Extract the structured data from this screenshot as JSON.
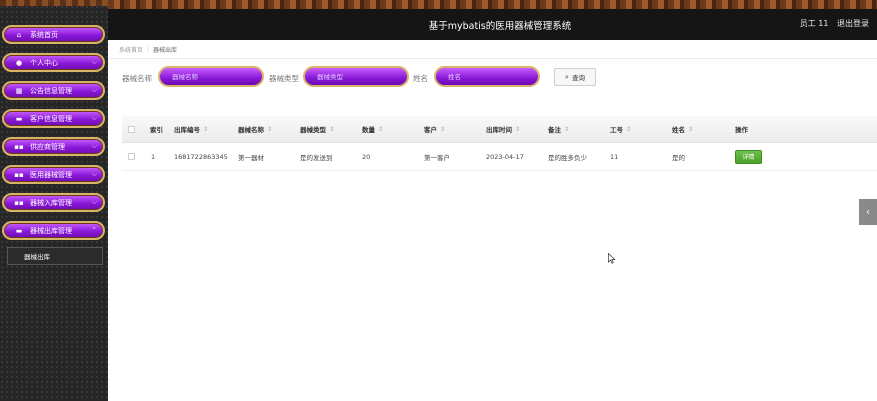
{
  "header": {
    "title": "基于mybatis的医用器械管理系统",
    "user": "员工 11",
    "logout": "退出登录"
  },
  "sidebar": {
    "items": [
      {
        "label": "系统首页",
        "icon": "home-icon",
        "glyph": "⌂",
        "chevron": false
      },
      {
        "label": "个人中心",
        "icon": "user-icon",
        "glyph": "●",
        "chevron": true
      },
      {
        "label": "公告信息管理",
        "icon": "calendar-icon",
        "glyph": "▦",
        "chevron": true
      },
      {
        "label": "客户信息管理",
        "icon": "briefcase-icon",
        "glyph": "▬",
        "chevron": true
      },
      {
        "label": "供应商管理",
        "icon": "grid-icon",
        "glyph": "▪▪",
        "chevron": true
      },
      {
        "label": "医用器械管理",
        "icon": "grid-icon",
        "glyph": "▪▪",
        "chevron": true
      },
      {
        "label": "器械入库管理",
        "icon": "grid-icon",
        "glyph": "▪▪",
        "chevron": true
      },
      {
        "label": "器械出库管理",
        "icon": "comment-icon",
        "glyph": "▬",
        "chevron": true,
        "expanded": true
      }
    ],
    "submenu": "器械出库"
  },
  "breadcrumb": {
    "home": "系统首页",
    "current": "器械出库"
  },
  "search": {
    "name_label": "器械名称",
    "name_placeholder": "器械名称",
    "type_label": "器械类型",
    "type_placeholder": "器械类型",
    "person_label": "姓名",
    "person_placeholder": "姓名",
    "button": "查询"
  },
  "table": {
    "headers": {
      "index": "索引",
      "out_no": "出库编号",
      "device_name": "器械名称",
      "device_type": "器械类型",
      "quantity": "数量",
      "customer": "客户",
      "out_time": "出库时间",
      "remark": "备注",
      "emp_no": "工号",
      "emp_name": "姓名",
      "action": "操作"
    },
    "sort_glyph": "⇕",
    "rows": [
      {
        "index": "1",
        "out_no": "1681722863345",
        "device_name": "第一器材",
        "device_type": "是的发送到",
        "quantity": "20",
        "customer": "第一客户",
        "out_time": "2023-04-17",
        "remark": "是的胜多负少",
        "emp_no": "11",
        "emp_name": "是的",
        "action": "详情"
      }
    ]
  },
  "colors": {
    "menu_purple": "#8a18d8",
    "menu_border": "#d9b36a",
    "header_bg": "#151515",
    "detail_green": "#4a9f2a"
  }
}
